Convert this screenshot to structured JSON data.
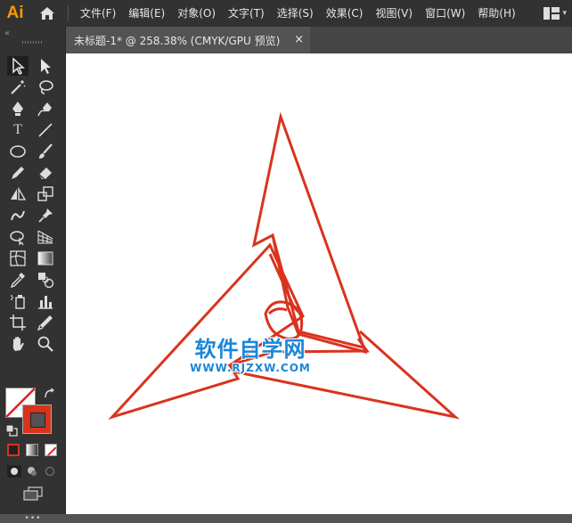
{
  "app": {
    "logo": "Ai"
  },
  "menu": {
    "items": [
      "文件(F)",
      "编辑(E)",
      "对象(O)",
      "文字(T)",
      "选择(S)",
      "效果(C)",
      "视图(V)",
      "窗口(W)",
      "帮助(H)"
    ]
  },
  "document": {
    "tab_title": "未标题-1* @ 258.38% (CMYK/GPU 预览)",
    "close_glyph": "×"
  },
  "toolbar": {
    "collapse_glyph": "«",
    "type_tool_glyph": "T",
    "more_glyph": "•••"
  },
  "colors": {
    "stroke": "#d9331e",
    "fill": "none",
    "accent_logo": "#ff9a00",
    "watermark": "#1a86d9"
  },
  "watermark": {
    "title": "软件自学网",
    "url": "WWW.RJZXW.COM"
  }
}
